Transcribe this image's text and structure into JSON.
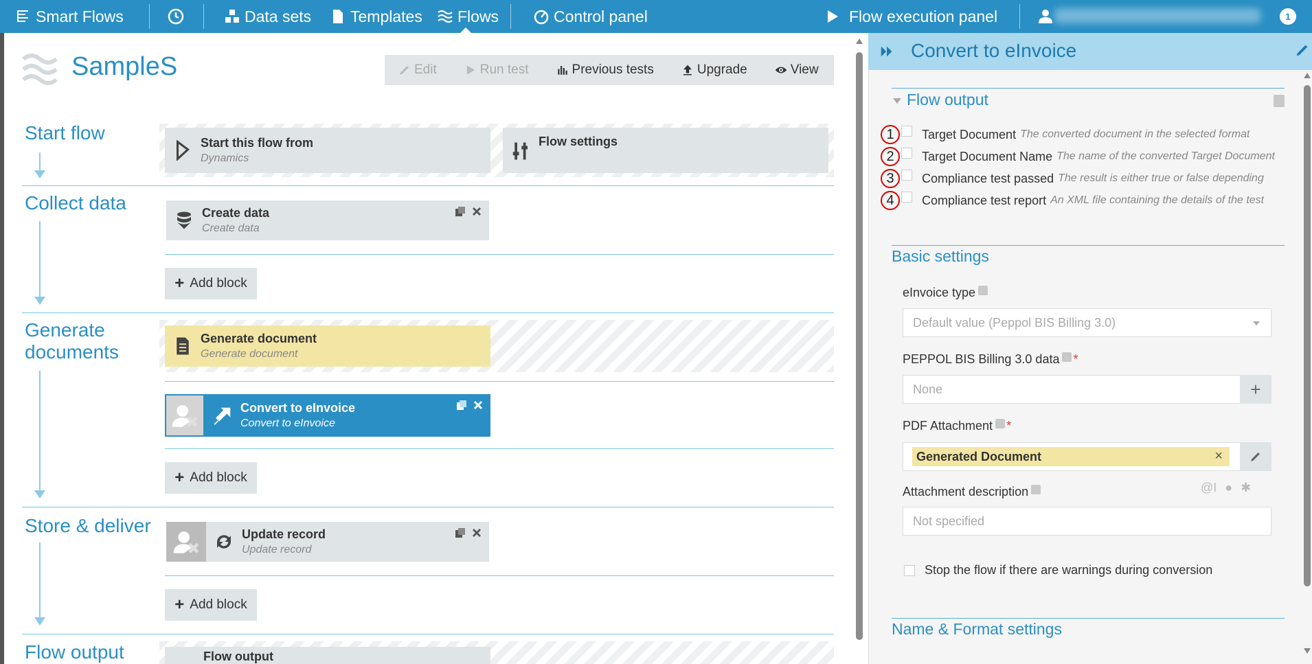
{
  "nav": {
    "brand": "Smart Flows",
    "datasets": "Data sets",
    "templates": "Templates",
    "flows": "Flows",
    "control_panel": "Control panel",
    "flow_execution_panel": "Flow execution panel",
    "notification_count": "1"
  },
  "page": {
    "title": "SampleS",
    "toolbar": {
      "edit": "Edit",
      "run_test": "Run test",
      "previous_tests": "Previous tests",
      "upgrade": "Upgrade",
      "view": "View"
    }
  },
  "sections": {
    "start_flow": "Start flow",
    "collect_data": "Collect data",
    "generate_documents_1": "Generate",
    "generate_documents_2": "documents",
    "store_deliver": "Store & deliver",
    "flow_output": "Flow output"
  },
  "blocks": {
    "start_from": {
      "name": "Start this flow from",
      "sub": "Dynamics"
    },
    "flow_settings": {
      "name": "Flow settings"
    },
    "create_data": {
      "name": "Create data",
      "sub": "Create data"
    },
    "generate_document": {
      "name": "Generate document",
      "sub": "Generate document"
    },
    "convert_einvoice": {
      "name": "Convert to eInvoice",
      "sub": "Convert to eInvoice"
    },
    "update_record": {
      "name": "Update record",
      "sub": "Update record"
    },
    "flow_output": {
      "name": "Flow output"
    }
  },
  "add_block": "Add block",
  "panel": {
    "title": "Convert to eInvoice",
    "flow_output_title": "Flow output",
    "outputs": [
      {
        "num": "1",
        "name": "Target Document",
        "desc": "The converted document in the selected format"
      },
      {
        "num": "2",
        "name": "Target Document Name",
        "desc": "The name of the converted Target Document"
      },
      {
        "num": "3",
        "name": "Compliance test passed",
        "desc": "The result is either true or false depending"
      },
      {
        "num": "4",
        "name": "Compliance test report",
        "desc": "An XML file containing the details of the test"
      }
    ],
    "basic_settings_title": "Basic settings",
    "einvoice_type_label": "eInvoice type",
    "einvoice_type_value": "Default value (Peppol BIS Billing 3.0)",
    "peppol_label": "PEPPOL BIS Billing 3.0 data",
    "peppol_value": "None",
    "pdf_label": "PDF Attachment",
    "pdf_chip": "Generated Document",
    "attachment_desc_label": "Attachment description",
    "attachment_desc_placeholder": "Not specified",
    "stop_flow_label": "Stop the flow if there are warnings during conversion",
    "name_format_title": "Name & Format settings",
    "required_mark": "*"
  },
  "colors": {
    "brand": "#2a8fc4",
    "panel_header": "#a9d8ef",
    "highlight_yellow": "#f3e6a5"
  }
}
